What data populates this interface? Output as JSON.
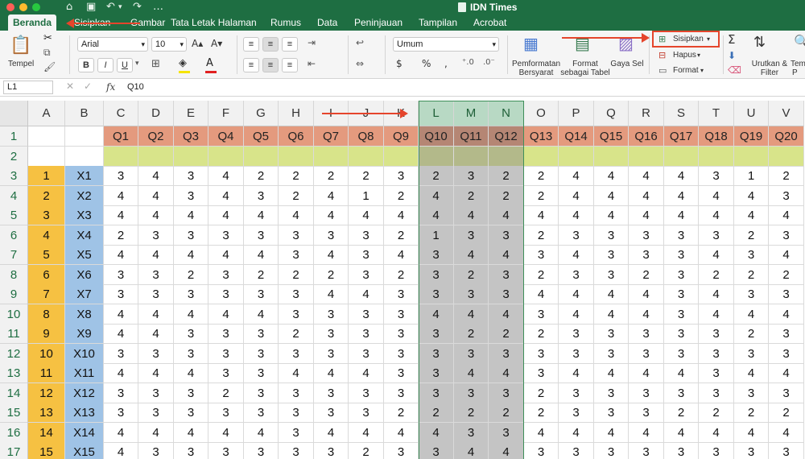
{
  "window": {
    "title": "IDN Times"
  },
  "tabs": [
    "Beranda",
    "Sisipkan",
    "Gambar",
    "Tata Letak Halaman",
    "Rumus",
    "Data",
    "Peninjauan",
    "Tampilan",
    "Acrobat"
  ],
  "ribbon": {
    "paste_label": "Tempel",
    "font_name": "Arial",
    "font_size": "10",
    "bold": "B",
    "italic": "I",
    "underline": "U",
    "number_format": "Umum",
    "currency": "$",
    "percent": "%",
    "thousands": ",",
    "conditional_format_label_1": "Pemformatan",
    "conditional_format_label_2": "Bersyarat",
    "format_table_label_1": "Format",
    "format_table_label_2": "sebagai Tabel",
    "cell_styles_label": "Gaya Sel",
    "insert_label": "Sisipkan",
    "delete_label": "Hapus",
    "format_label": "Format",
    "sort_filter_label_1": "Urutkan &",
    "sort_filter_label_2": "Filter",
    "truncated_label": "Tem",
    "truncated_label_2": "P"
  },
  "formula_bar": {
    "name_box": "L1",
    "fx": "fx",
    "formula": "Q10"
  },
  "columns": [
    "A",
    "B",
    "C",
    "D",
    "E",
    "F",
    "G",
    "H",
    "I",
    "J",
    "K",
    "L",
    "M",
    "N",
    "O",
    "P",
    "Q",
    "R",
    "S",
    "T",
    "U",
    "V"
  ],
  "row_numbers": [
    "1",
    "2",
    "3",
    "4",
    "5",
    "6",
    "7",
    "8",
    "9",
    "10",
    "11",
    "12",
    "13",
    "14",
    "15",
    "16",
    "17"
  ],
  "question_headers": [
    "Q1",
    "Q2",
    "Q3",
    "Q4",
    "Q5",
    "Q6",
    "Q7",
    "Q8",
    "Q9",
    "Q10",
    "Q11",
    "Q12",
    "Q13",
    "Q14",
    "Q15",
    "Q16",
    "Q17",
    "Q18",
    "Q19",
    "Q20"
  ],
  "rows": [
    {
      "no": "1",
      "id": "X1",
      "values": [
        "3",
        "4",
        "3",
        "4",
        "2",
        "2",
        "2",
        "2",
        "3",
        "2",
        "3",
        "2",
        "2",
        "4",
        "4",
        "4",
        "4",
        "3",
        "1",
        "2"
      ]
    },
    {
      "no": "2",
      "id": "X2",
      "values": [
        "4",
        "4",
        "3",
        "4",
        "3",
        "2",
        "4",
        "1",
        "2",
        "4",
        "2",
        "2",
        "2",
        "4",
        "4",
        "4",
        "4",
        "4",
        "4",
        "3"
      ]
    },
    {
      "no": "3",
      "id": "X3",
      "values": [
        "4",
        "4",
        "4",
        "4",
        "4",
        "4",
        "4",
        "4",
        "4",
        "4",
        "4",
        "4",
        "4",
        "4",
        "4",
        "4",
        "4",
        "4",
        "4",
        "4"
      ]
    },
    {
      "no": "4",
      "id": "X4",
      "values": [
        "2",
        "3",
        "3",
        "3",
        "3",
        "3",
        "3",
        "3",
        "2",
        "1",
        "3",
        "3",
        "2",
        "3",
        "3",
        "3",
        "3",
        "3",
        "2",
        "3"
      ]
    },
    {
      "no": "5",
      "id": "X5",
      "values": [
        "4",
        "4",
        "4",
        "4",
        "4",
        "3",
        "4",
        "3",
        "4",
        "3",
        "4",
        "4",
        "3",
        "4",
        "3",
        "3",
        "3",
        "4",
        "3",
        "4"
      ]
    },
    {
      "no": "6",
      "id": "X6",
      "values": [
        "3",
        "3",
        "2",
        "3",
        "2",
        "2",
        "2",
        "3",
        "2",
        "3",
        "2",
        "3",
        "2",
        "3",
        "3",
        "2",
        "3",
        "2",
        "2",
        "2"
      ]
    },
    {
      "no": "7",
      "id": "X7",
      "values": [
        "3",
        "3",
        "3",
        "3",
        "3",
        "3",
        "4",
        "4",
        "3",
        "3",
        "3",
        "3",
        "4",
        "4",
        "4",
        "4",
        "3",
        "4",
        "3",
        "3"
      ]
    },
    {
      "no": "8",
      "id": "X8",
      "values": [
        "4",
        "4",
        "4",
        "4",
        "4",
        "3",
        "3",
        "3",
        "3",
        "4",
        "4",
        "4",
        "3",
        "4",
        "4",
        "4",
        "3",
        "4",
        "4",
        "4"
      ]
    },
    {
      "no": "9",
      "id": "X9",
      "values": [
        "4",
        "4",
        "3",
        "3",
        "3",
        "2",
        "3",
        "3",
        "3",
        "3",
        "2",
        "2",
        "2",
        "3",
        "3",
        "3",
        "3",
        "3",
        "2",
        "3"
      ]
    },
    {
      "no": "10",
      "id": "X10",
      "values": [
        "3",
        "3",
        "3",
        "3",
        "3",
        "3",
        "3",
        "3",
        "3",
        "3",
        "3",
        "3",
        "3",
        "3",
        "3",
        "3",
        "3",
        "3",
        "3",
        "3"
      ]
    },
    {
      "no": "11",
      "id": "X11",
      "values": [
        "4",
        "4",
        "4",
        "3",
        "3",
        "4",
        "4",
        "4",
        "3",
        "3",
        "4",
        "4",
        "3",
        "4",
        "4",
        "4",
        "4",
        "3",
        "4",
        "4"
      ]
    },
    {
      "no": "12",
      "id": "X12",
      "values": [
        "3",
        "3",
        "3",
        "2",
        "3",
        "3",
        "3",
        "3",
        "3",
        "3",
        "3",
        "3",
        "2",
        "3",
        "3",
        "3",
        "3",
        "3",
        "3",
        "3"
      ]
    },
    {
      "no": "13",
      "id": "X13",
      "values": [
        "3",
        "3",
        "3",
        "3",
        "3",
        "3",
        "3",
        "3",
        "2",
        "2",
        "2",
        "2",
        "2",
        "3",
        "3",
        "3",
        "2",
        "2",
        "2",
        "2"
      ]
    },
    {
      "no": "14",
      "id": "X14",
      "values": [
        "4",
        "4",
        "4",
        "4",
        "4",
        "3",
        "4",
        "4",
        "4",
        "4",
        "3",
        "3",
        "4",
        "4",
        "4",
        "4",
        "4",
        "4",
        "4",
        "4"
      ]
    },
    {
      "no": "15",
      "id": "X15",
      "values": [
        "4",
        "3",
        "3",
        "3",
        "3",
        "3",
        "3",
        "2",
        "3",
        "3",
        "4",
        "4",
        "3",
        "3",
        "3",
        "3",
        "3",
        "3",
        "3",
        "3"
      ]
    }
  ],
  "colors": {
    "ribbon_green": "#1e6e42",
    "header_salmon": "#e49a7e",
    "row2_lime": "#d8e48a",
    "col_a_orange": "#f6c142",
    "col_b_blue": "#9fc3e6",
    "selection_gray": "#c4c4c4",
    "annotation_red": "#e5452c"
  }
}
